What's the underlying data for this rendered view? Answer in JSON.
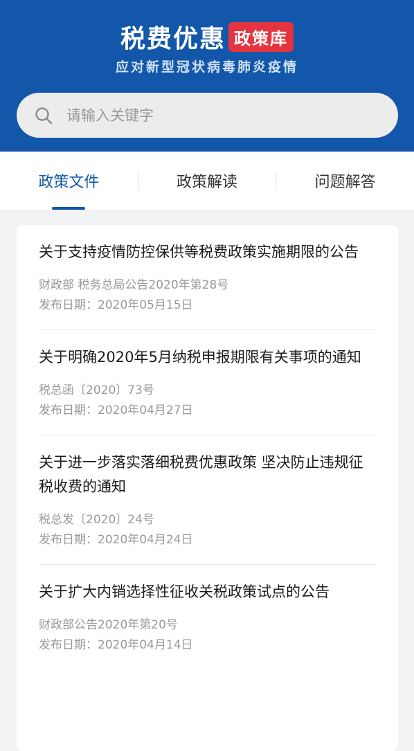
{
  "header": {
    "logo_main": "税费优惠",
    "logo_badge": "政策库",
    "subtitle": "应对新型冠状病毒肺炎疫情",
    "background_color": "#1257a9",
    "badge_color": "#e3343f"
  },
  "search": {
    "icon": "search-icon",
    "placeholder": "请输入关键字",
    "value": ""
  },
  "tabs": [
    {
      "label": "政策文件",
      "active": true
    },
    {
      "label": "政策解读",
      "active": false
    },
    {
      "label": "问题解答",
      "active": false
    }
  ],
  "items": [
    {
      "title": "关于支持疫情防控保供等税费政策实施期限的公告",
      "source": "财政部 税务总局公告2020年第28号",
      "date": "发布日期：2020年05月15日"
    },
    {
      "title": "关于明确2020年5月纳税申报期限有关事项的通知",
      "source": "税总函〔2020〕73号",
      "date": "发布日期：2020年04月27日"
    },
    {
      "title": "关于进一步落实落细税费优惠政策 坚决防止违规征税收费的通知",
      "source": "税总发〔2020〕24号",
      "date": "发布日期：2020年04月24日"
    },
    {
      "title": "关于扩大内销选择性征收关税政策试点的公告",
      "source": "财政部公告2020年第20号",
      "date": "发布日期：2020年04月14日"
    }
  ]
}
